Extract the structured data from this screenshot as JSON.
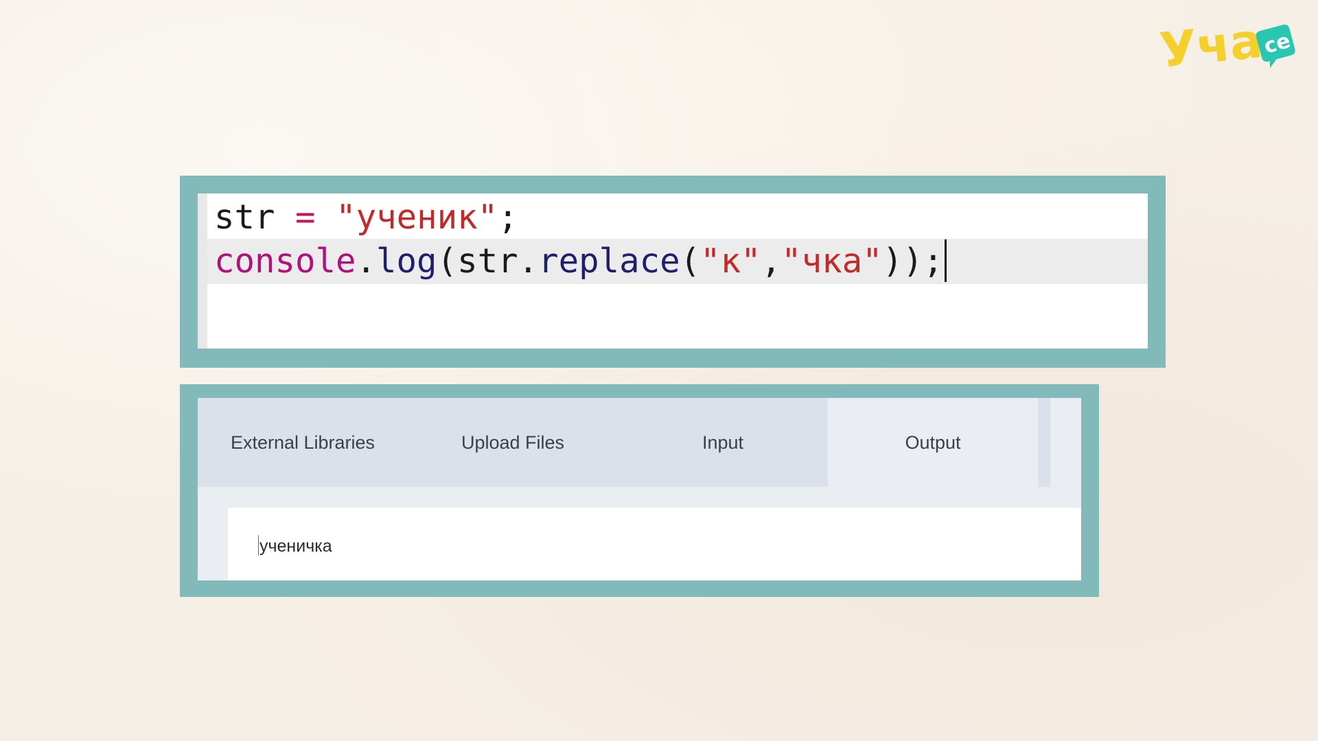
{
  "brand": {
    "logo_text": "Уча",
    "logo_badge": "се",
    "colors": {
      "yellow": "#f5cf2a",
      "teal": "#27c7b0",
      "frame": "#82b9bb"
    }
  },
  "code": {
    "line1": {
      "ident": "str",
      "op": "=",
      "string": "\"ученик\"",
      "end": ";"
    },
    "line2": {
      "object": "console",
      "dot1": ".",
      "method": "log",
      "open": "(",
      "arg_obj": "str",
      "dot2": ".",
      "arg_method": "replace",
      "open2": "(",
      "str_a": "\"к\"",
      "comma": ",",
      "str_b": "\"чка\"",
      "close": "));"
    }
  },
  "tabs": [
    {
      "label": "External Libraries",
      "active": false
    },
    {
      "label": "Upload Files",
      "active": false
    },
    {
      "label": "Input",
      "active": false
    },
    {
      "label": "Output",
      "active": true
    }
  ],
  "output": {
    "text": "ученичка"
  }
}
